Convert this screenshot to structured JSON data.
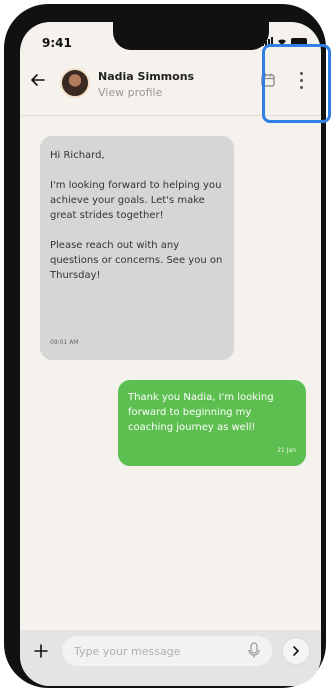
{
  "status_bar": {
    "time": "9:41"
  },
  "header": {
    "back_icon": "arrow-left-icon",
    "contact_name": "Nadia Simmons",
    "subtitle": "View profile",
    "calendar_icon": "calendar-icon",
    "more_icon": "more-vertical-icon"
  },
  "messages": [
    {
      "direction": "incoming",
      "paragraphs": [
        "Hi Richard,",
        "I'm looking forward to helping you achieve your goals. Let's make great strides together!",
        "Please reach out with any questions or concerns. See you on Thursday!"
      ],
      "time": "09:01 AM"
    },
    {
      "direction": "outgoing",
      "text": "Thank you Nadia, I'm looking forward to beginning my coaching journey as well!",
      "time": "21 Jan"
    }
  ],
  "composer": {
    "placeholder": "Type your message",
    "plus_icon": "plus-icon",
    "mic_icon": "microphone-icon",
    "send_icon": "chevron-right-icon"
  },
  "colors": {
    "outgoing_bubble": "#5cbf4f",
    "incoming_bubble": "#d6d6d6",
    "highlight": "#2f80e6"
  }
}
